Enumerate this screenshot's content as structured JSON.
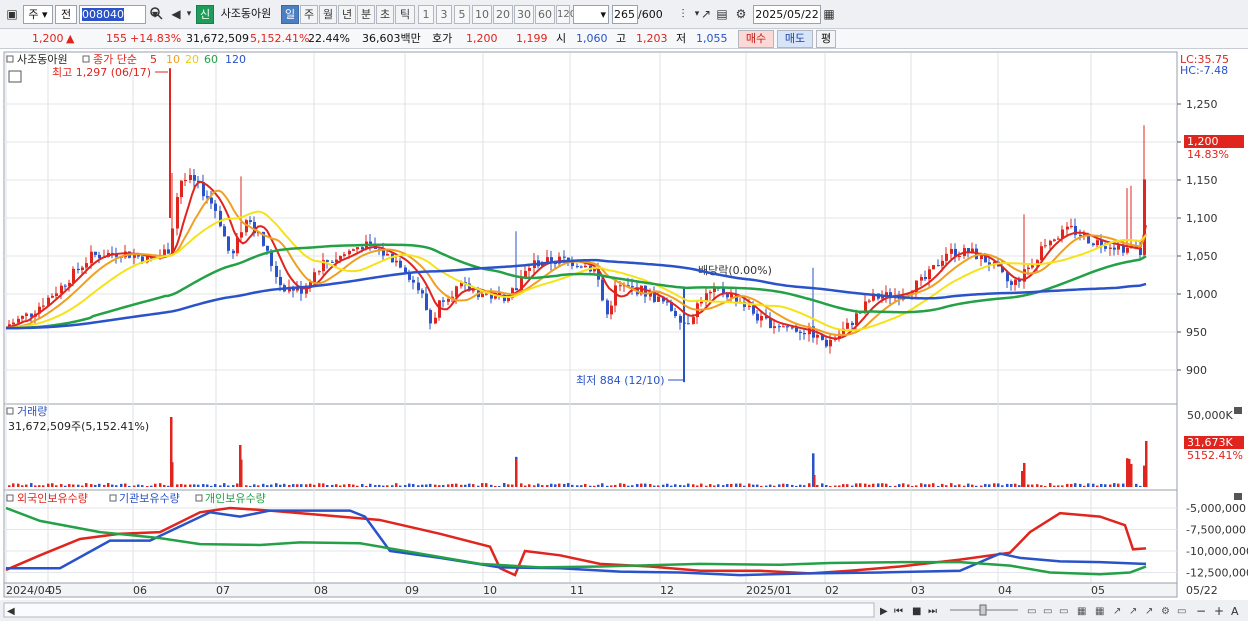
{
  "toolbar": {
    "market": "주",
    "view": "전",
    "code": "008040",
    "name_btn": "신",
    "name": "사조동아원",
    "periods": [
      "일",
      "주",
      "월",
      "년",
      "분",
      "초",
      "틱"
    ],
    "active_period": "일",
    "intervals": [
      "1",
      "3",
      "5",
      "10",
      "20",
      "30",
      "60",
      "120"
    ],
    "count": "265",
    "count_total": "/600",
    "date": "2025/05/22"
  },
  "quote": {
    "price": "1,200",
    "change": "155",
    "change_pct": "+14.83%",
    "volume": "31,672,509",
    "volume_pct": "5,152.41%",
    "turnover": "22.44%",
    "amount": "36,603백만",
    "ask_label": "호가",
    "ask": "1,200",
    "bid": "1,199",
    "open_label": "시",
    "open": "1,060",
    "high_label": "고",
    "high": "1,203",
    "low_label": "저",
    "low": "1,055",
    "buy": "매수",
    "sell": "매도",
    "eval": "평"
  },
  "price_panel": {
    "name": "사조동아원",
    "ma_label": "종가 단순",
    "ma_periods": [
      "5",
      "10",
      "20",
      "60",
      "120"
    ],
    "ma_colors": [
      "#e0241e",
      "#f0a020",
      "#f6e21a",
      "#24a047",
      "#2a52c9"
    ],
    "lc": "LC:35.75",
    "hc": "HC:-7.48",
    "high_marker": "최고 1,297 (06/17)",
    "low_marker": "최저 884 (12/10)",
    "dividend": "배당락(0.00%)",
    "y_ticks": [
      "1,250",
      "1,200",
      "1,150",
      "1,100",
      "1,050",
      "1,000",
      "950",
      "900"
    ],
    "last_price": "1,200",
    "last_pct": "14.83%"
  },
  "volume_panel": {
    "title": "거래량",
    "value": "31,672,509주(5,152.41%)",
    "y_tick": "50,000K",
    "last": "31,673K",
    "last_pct": "5152.41%"
  },
  "holding_panel": {
    "series": [
      "외국인보유수량",
      "기관보유수량",
      "개인보유수량"
    ],
    "colors": [
      "#e0241e",
      "#2a52c9",
      "#24a047"
    ],
    "y_ticks": [
      "-5,000,000",
      "-7,500,000",
      "-10,000,000",
      "-12,500,000"
    ]
  },
  "x_axis": {
    "labels": [
      "2024/04",
      "05",
      "06",
      "07",
      "08",
      "09",
      "10",
      "11",
      "12",
      "2025/01",
      "02",
      "03",
      "04",
      "05"
    ],
    "right_label": "05/22"
  }
}
